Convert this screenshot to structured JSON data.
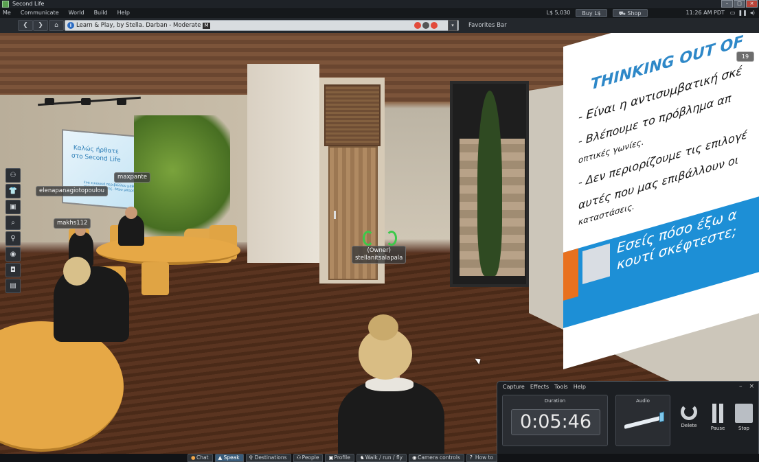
{
  "window": {
    "title": "Second Life"
  },
  "menubar": {
    "items": [
      "Me",
      "Communicate",
      "World",
      "Build",
      "Help"
    ],
    "balance": "L$ 5,030",
    "buy_label": "Buy L$",
    "shop_label": "Shop",
    "clock": "11:26 AM PDT"
  },
  "navbar": {
    "location": "Learn & Play, by Stella. Darban - Moderate",
    "maturity_badge": "M",
    "favorites_label": "Favorites Bar"
  },
  "scene": {
    "slide": {
      "title": "THINKING OUT OF",
      "lines": [
        "- Είναι η αντισυμβατική σκέ",
        "- Βλέπουμε το πρόβλημα απ",
        "οπτικές γωνίες.",
        "- Δεν περιορίζουμε τις επιλογέ",
        "αυτές που μας επιβάλλουν οι",
        "καταστάσεις."
      ],
      "question": "Εσείς πόσο έξω α\nκουτί σκέφτεστε;"
    },
    "count_badge": "19",
    "left_screen": {
      "title": "Καλώς ήρθατε\nστο Second Life",
      "subtext": "ένα εικονικό περιβάλλον μάθησης και αλληλεπίδρασης, όπου μπορείτε να γνωρίσετε νέους φίλους"
    },
    "name_tags": {
      "elena": "elenapanagiotopoulou",
      "maxpante": "maxpante",
      "makhs": "makhs112",
      "owner_role": "(Owner)",
      "owner_name": "stellanitsalapala"
    }
  },
  "sidebar": {
    "buttons": [
      {
        "name": "people-icon",
        "glyph": "⚇"
      },
      {
        "name": "appearance-icon",
        "glyph": "👕"
      },
      {
        "name": "inventory-icon",
        "glyph": "▣"
      },
      {
        "name": "search-icon",
        "glyph": "⌕"
      },
      {
        "name": "places-icon",
        "glyph": "⚲"
      },
      {
        "name": "radio-icon",
        "glyph": "◉"
      },
      {
        "name": "snapshot-icon",
        "glyph": "◘"
      },
      {
        "name": "map-icon",
        "glyph": "▤"
      }
    ]
  },
  "recorder": {
    "menu": [
      "Capture",
      "Effects",
      "Tools",
      "Help"
    ],
    "duration_label": "Duration",
    "time": "0:05:46",
    "audio_label": "Audio",
    "audio_level": 0.85,
    "delete_label": "Delete",
    "pause_label": "Pause",
    "stop_label": "Stop",
    "minimize": "–",
    "close": "×"
  },
  "bottombar": {
    "chat": "Chat",
    "speak": "Speak",
    "destinations": "Destinations",
    "people": "People",
    "profile": "Profile",
    "walk": "Walk / run / fly",
    "camera": "Camera controls",
    "howto": "How to"
  },
  "colors": {
    "slide_accent": "#2e88c8",
    "banner_blue": "#1d8fd6",
    "voice_green": "#3bc94a"
  }
}
